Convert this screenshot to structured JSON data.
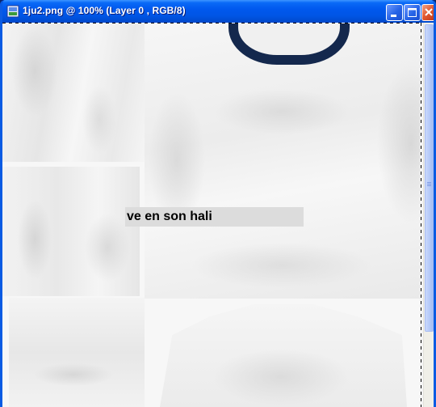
{
  "window": {
    "title": "1ju2.png @ 100% (Layer 0 , RGB/8)",
    "app_icon": "photoshop-document-icon",
    "controls": {
      "minimize": "minimize-icon",
      "maximize": "maximize-icon",
      "close": "close-icon"
    }
  },
  "canvas": {
    "text_layer": "ve en son hali",
    "collar_color": "#14284d",
    "background_color": "#f7f7f7"
  },
  "scrollbar": {
    "orientation": "vertical"
  }
}
